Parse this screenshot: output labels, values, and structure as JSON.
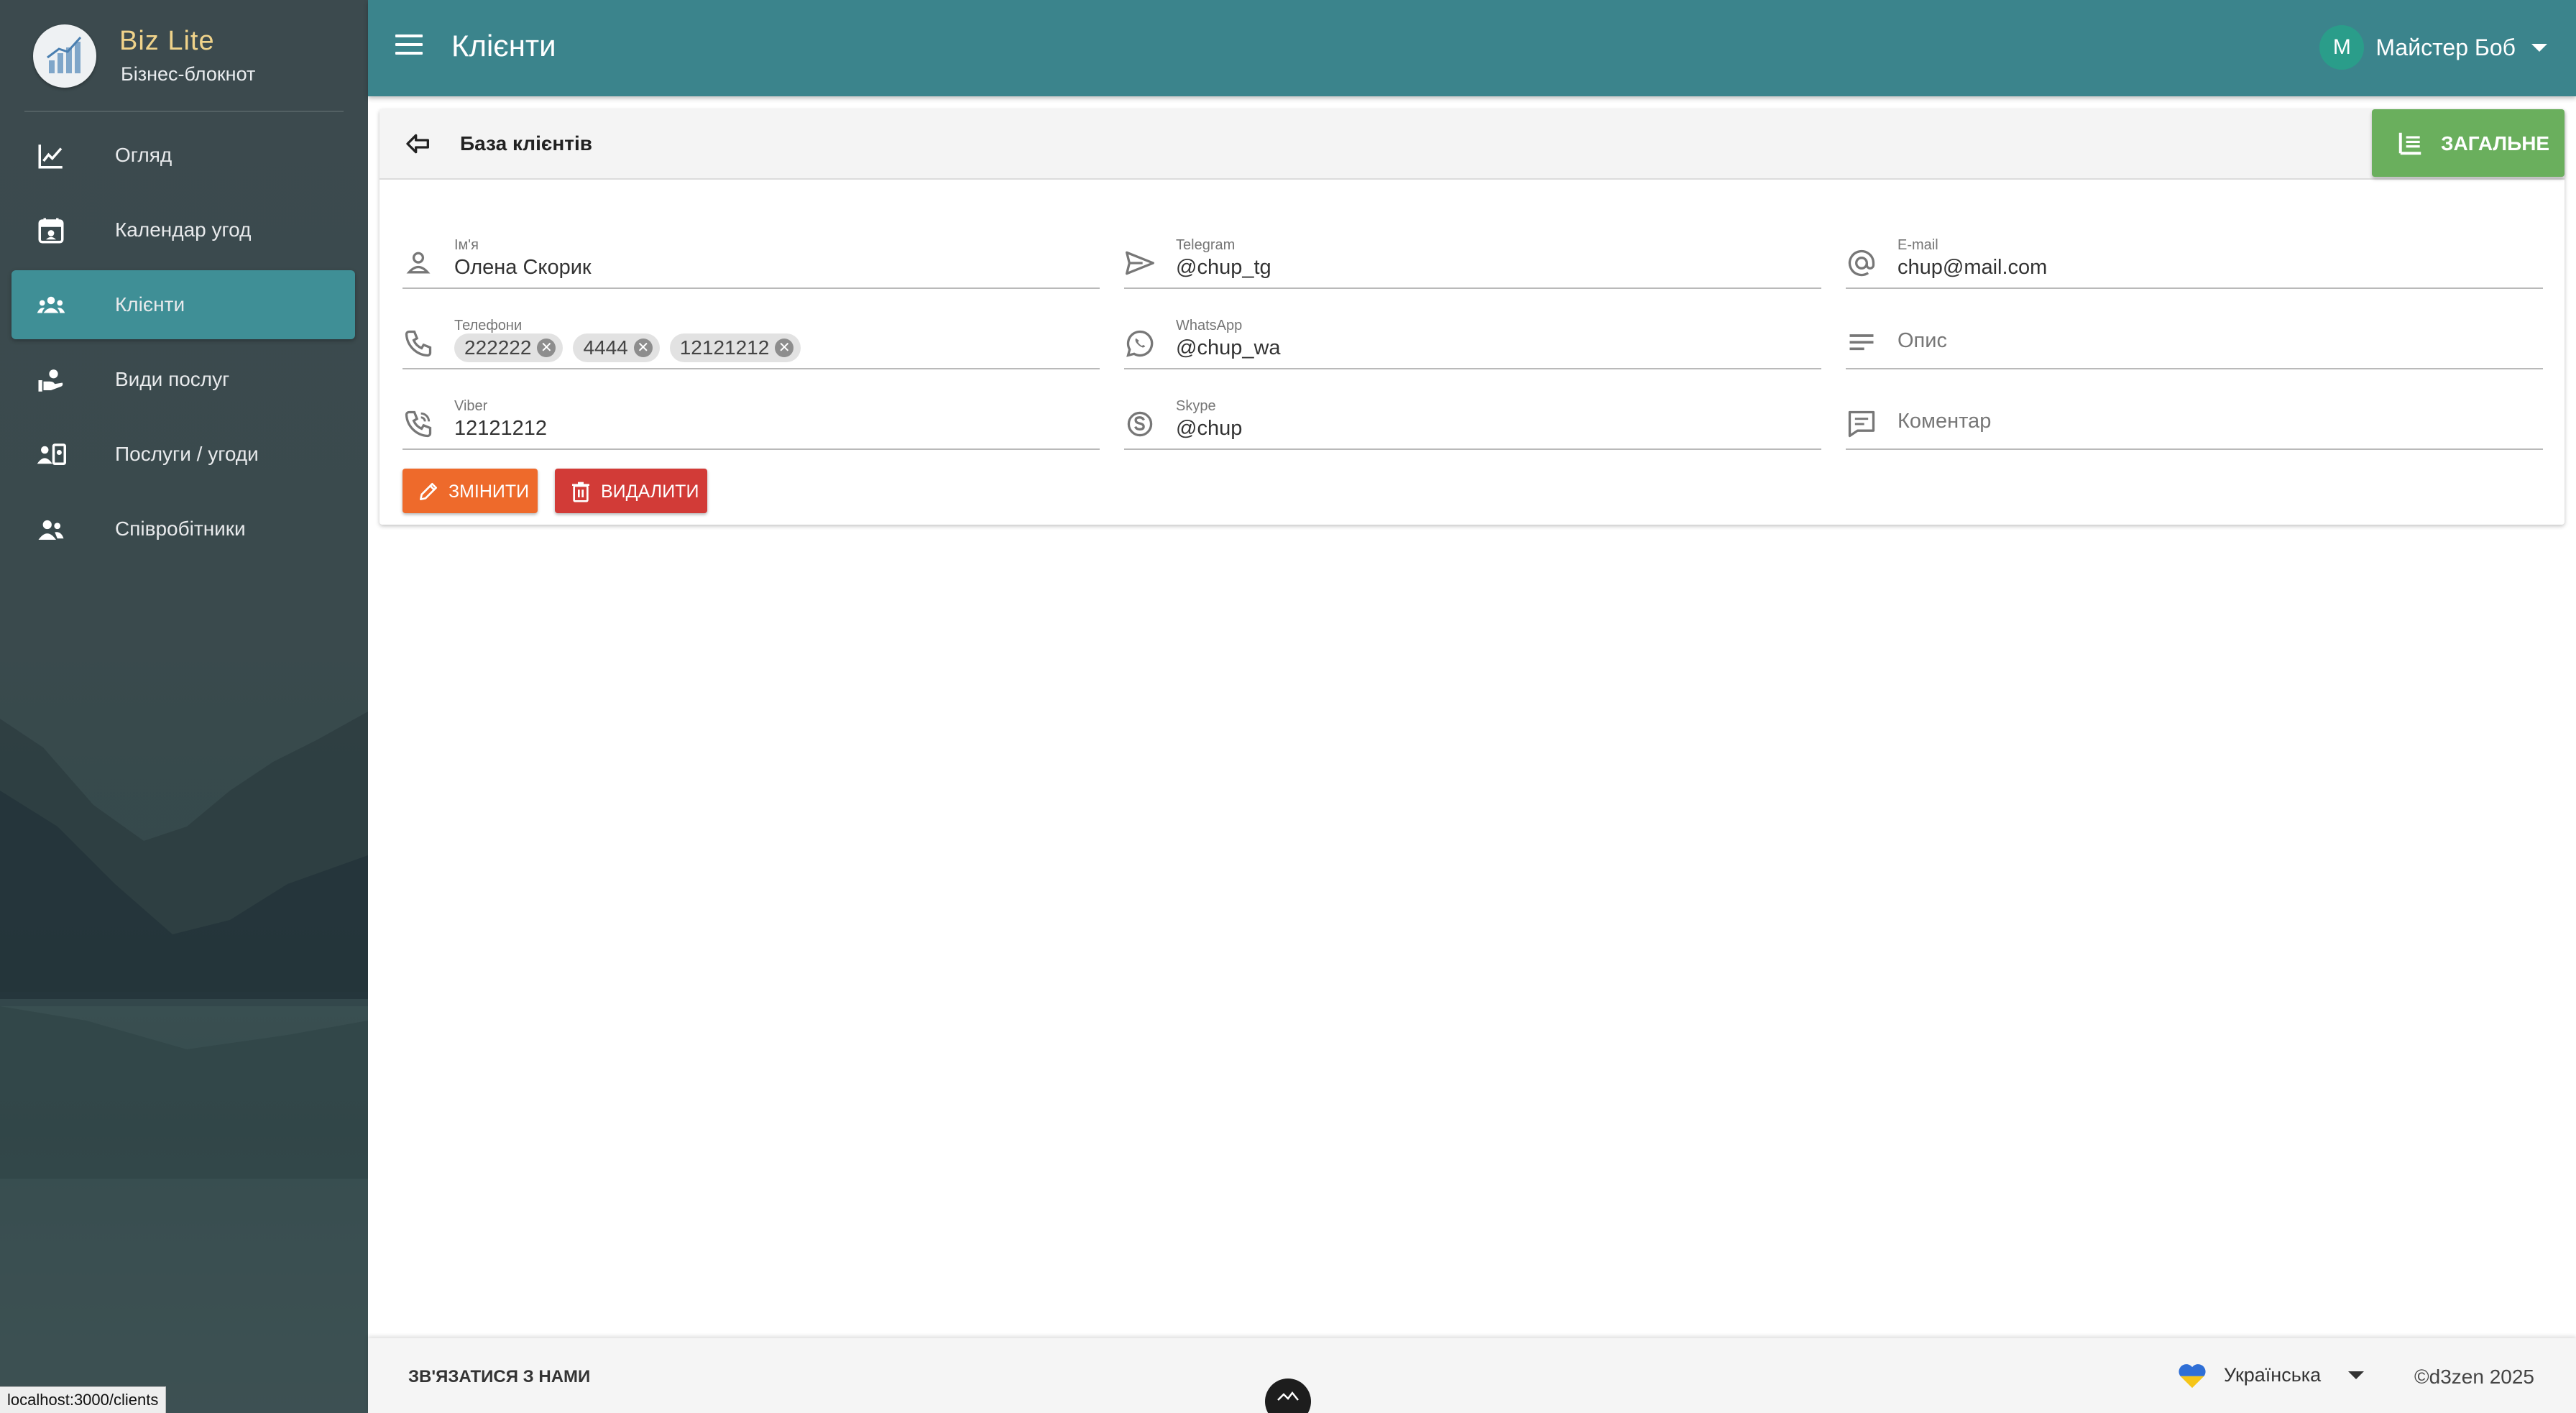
{
  "brand": {
    "name": "Biz Lite",
    "subtitle": "Бізнес-блокнот"
  },
  "sidebar": {
    "items": [
      {
        "label": "Огляд",
        "icon": "line-chart-icon",
        "active": false
      },
      {
        "label": "Календар угод",
        "icon": "calendar-icon",
        "active": false
      },
      {
        "label": "Клієнти",
        "icon": "group-icon",
        "active": true
      },
      {
        "label": "Види послуг",
        "icon": "hand-person-icon",
        "active": false
      },
      {
        "label": "Послуги / угоди",
        "icon": "person-card-icon",
        "active": false
      },
      {
        "label": "Співробітники",
        "icon": "people-icon",
        "active": false
      }
    ]
  },
  "header": {
    "title": "Клієнти",
    "user": {
      "initial": "M",
      "name": "Майстер Боб"
    }
  },
  "card": {
    "title": "База клієнтів",
    "general_button": "ЗАГАЛЬНЕ",
    "fields": {
      "name": {
        "label": "Ім'я",
        "value": "Олена Скорик",
        "icon": "person-icon"
      },
      "telegram": {
        "label": "Telegram",
        "value": "@chup_tg",
        "icon": "send-icon"
      },
      "email": {
        "label": "E-mail",
        "value": "chup@mail.com",
        "icon": "at-icon"
      },
      "phones": {
        "label": "Телефони",
        "values": [
          "222222",
          "4444",
          "12121212"
        ],
        "icon": "phone-icon"
      },
      "whatsapp": {
        "label": "WhatsApp",
        "value": "@chup_wa",
        "icon": "whatsapp-icon"
      },
      "description": {
        "placeholder": "Опис",
        "icon": "lines-icon"
      },
      "viber": {
        "label": "Viber",
        "value": "12121212",
        "icon": "viber-icon"
      },
      "skype": {
        "label": "Skype",
        "value": "@chup",
        "icon": "skype-icon"
      },
      "comment": {
        "placeholder": "Коментар",
        "icon": "comment-icon"
      }
    },
    "edit_button": "ЗМІНИТИ",
    "delete_button": "ВИДАЛИТИ"
  },
  "footer": {
    "contact": "ЗВ'ЯЗАТИСЯ З НАМИ",
    "language": "Українська",
    "copyright": "©d3zen 2025"
  },
  "status_url": "localhost:3000/clients",
  "colors": {
    "topbar": "#3b848c",
    "active_nav": "#3f8f96",
    "general_button": "#6aaf5d",
    "edit_button": "#ee6a2b",
    "delete_button": "#d23b37",
    "brand_name": "#f0d38a"
  }
}
